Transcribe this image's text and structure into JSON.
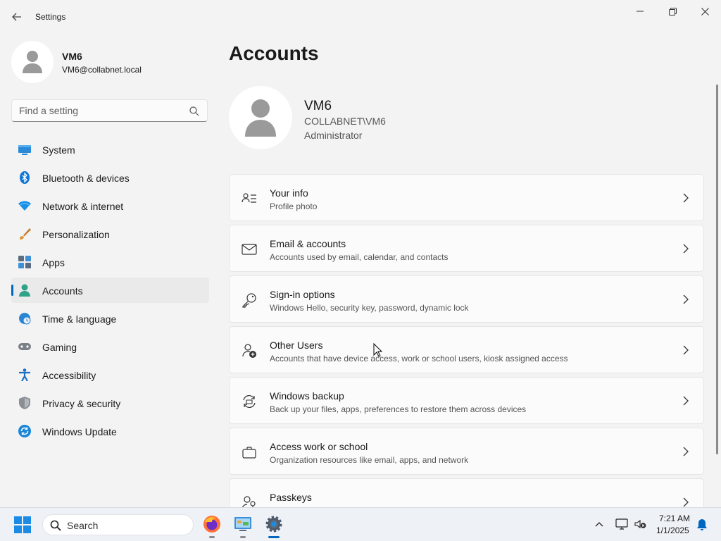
{
  "window": {
    "title": "Settings",
    "back_icon": "back-arrow-icon",
    "minimize_icon": "minimize-icon",
    "maximize_icon": "restore-icon",
    "close_icon": "close-icon"
  },
  "profile": {
    "name": "VM6",
    "email": "VM6@collabnet.local"
  },
  "search": {
    "placeholder": "Find a setting"
  },
  "sidebar": {
    "items": [
      {
        "label": "System",
        "icon": "system-icon",
        "active": false
      },
      {
        "label": "Bluetooth & devices",
        "icon": "bluetooth-icon",
        "active": false
      },
      {
        "label": "Network & internet",
        "icon": "wifi-icon",
        "active": false
      },
      {
        "label": "Personalization",
        "icon": "brush-icon",
        "active": false
      },
      {
        "label": "Apps",
        "icon": "apps-icon",
        "active": false
      },
      {
        "label": "Accounts",
        "icon": "accounts-icon",
        "active": true
      },
      {
        "label": "Time & language",
        "icon": "globe-clock-icon",
        "active": false
      },
      {
        "label": "Gaming",
        "icon": "gamepad-icon",
        "active": false
      },
      {
        "label": "Accessibility",
        "icon": "accessibility-icon",
        "active": false
      },
      {
        "label": "Privacy & security",
        "icon": "shield-icon",
        "active": false
      },
      {
        "label": "Windows Update",
        "icon": "update-icon",
        "active": false
      }
    ]
  },
  "main": {
    "title": "Accounts",
    "account": {
      "name": "VM6",
      "domain": "COLLABNET\\VM6",
      "role": "Administrator"
    },
    "cards": [
      {
        "title": "Your info",
        "subtitle": "Profile photo",
        "icon": "person-details-icon"
      },
      {
        "title": "Email & accounts",
        "subtitle": "Accounts used by email, calendar, and contacts",
        "icon": "mail-icon"
      },
      {
        "title": "Sign-in options",
        "subtitle": "Windows Hello, security key, password, dynamic lock",
        "icon": "key-icon"
      },
      {
        "title": "Other Users",
        "subtitle": "Accounts that have device access, work or school users, kiosk assigned access",
        "icon": "person-add-icon"
      },
      {
        "title": "Windows backup",
        "subtitle": "Back up your files, apps, preferences to restore them across devices",
        "icon": "backup-icon"
      },
      {
        "title": "Access work or school",
        "subtitle": "Organization resources like email, apps, and network",
        "icon": "briefcase-icon"
      },
      {
        "title": "Passkeys",
        "subtitle": "",
        "icon": "passkey-icon"
      }
    ]
  },
  "taskbar": {
    "search_label": "Search",
    "apps": [
      "firefox-icon",
      "control-panel-icon",
      "settings-gear-icon"
    ],
    "time": "7:21 AM",
    "date": "1/1/2025"
  },
  "colors": {
    "accent": "#0067c0",
    "background": "#f3f3f3",
    "card": "#fbfbfb"
  }
}
